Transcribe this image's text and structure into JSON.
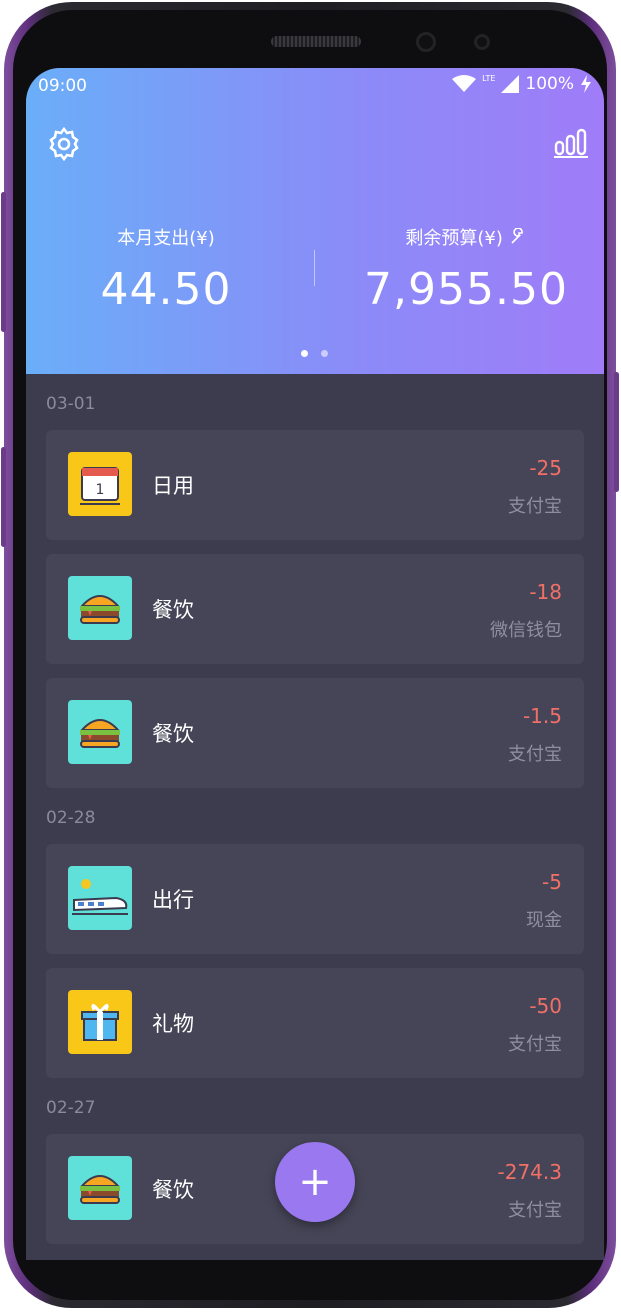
{
  "status_bar": {
    "time": "09:00",
    "network": "LTE",
    "battery": "100%"
  },
  "header": {
    "settings_icon": "gear-icon",
    "stats_icon": "stats-icon",
    "spent_label": "本月支出(¥)",
    "spent_value": "44.50",
    "budget_label": "剩余预算(¥)",
    "budget_value": "7,955.50",
    "budget_edit_icon": "wrench-icon",
    "page_dots": 2,
    "active_dot": 0
  },
  "days": [
    {
      "date": "03-01",
      "entries": [
        {
          "icon": "calendar-icon",
          "category": "日用",
          "amount": "-25",
          "payment": "支付宝"
        },
        {
          "icon": "burger-icon",
          "category": "餐饮",
          "amount": "-18",
          "payment": "微信钱包"
        },
        {
          "icon": "burger-icon",
          "category": "餐饮",
          "amount": "-1.5",
          "payment": "支付宝"
        }
      ]
    },
    {
      "date": "02-28",
      "entries": [
        {
          "icon": "train-icon",
          "category": "出行",
          "amount": "-5",
          "payment": "现金"
        },
        {
          "icon": "gift-icon",
          "category": "礼物",
          "amount": "-50",
          "payment": "支付宝"
        }
      ]
    },
    {
      "date": "02-27",
      "entries": [
        {
          "icon": "burger-icon",
          "category": "餐饮",
          "amount": "-274.3",
          "payment": "支付宝"
        }
      ]
    }
  ],
  "fab": {
    "label": "+",
    "icon": "plus-icon"
  },
  "colors": {
    "header_start": "#6aaef8",
    "header_end": "#a07cf8",
    "list_bg": "#3c3c4e",
    "card_bg": "#454557",
    "expense": "#f07068",
    "fab": "#9a78f0"
  }
}
